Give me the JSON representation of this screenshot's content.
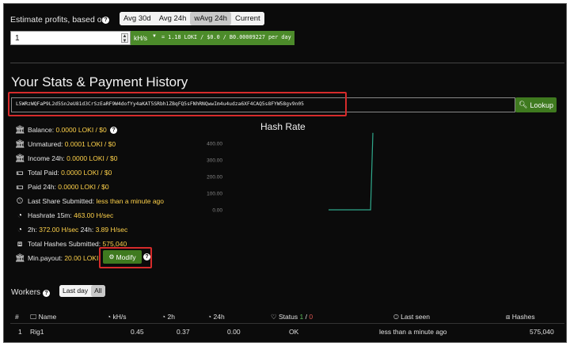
{
  "estimate": {
    "label": "Estimate profits, based on",
    "tabs": [
      "Avg 30d",
      "Avg 24h",
      "wAvg 24h",
      "Current"
    ],
    "active_tab": "wAvg 24h",
    "hashrate_value": "1",
    "unit": "kH/s",
    "result": "= 1.18 LOKI / $0.0 / B0.00009227 per day"
  },
  "stats": {
    "title": "Your Stats & Payment History",
    "address": "L5WRzWQFaP9L2d5Sn2eU81d3CrSzEaRF9W4dofYy4aKAT5SRbh1ZBqFQ5sFNhRNQwwIm4u4udza6XF4CAQ5s8FYW58gv9n05",
    "lookup_label": "Lookup"
  },
  "items": {
    "balance": {
      "label": "Balance:",
      "value": "0.0000 LOKI / $0"
    },
    "unmatured": {
      "label": "Unmatured:",
      "value": "0.0001 LOKI / $0"
    },
    "income24": {
      "label": "Income 24h:",
      "value": "0.0000 LOKI / $0"
    },
    "total_paid": {
      "label": "Total Paid:",
      "value": "0.0000 LOKI / $0"
    },
    "paid24": {
      "label": "Paid 24h:",
      "value": "0.0000 LOKI / $0"
    },
    "last_share": {
      "label": "Last Share Submitted:",
      "value": "less than a minute ago"
    },
    "hashrate15": {
      "label": "Hashrate 15m:",
      "value": "463.00 H/sec"
    },
    "hashrate2h": {
      "label2h": "2h:",
      "value2h": "372.00 H/sec",
      "label24": "24h:",
      "value24": "3.89 H/sec"
    },
    "total_hashes": {
      "label": "Total Hashes Submitted:",
      "value": "575,040"
    },
    "min_payout": {
      "label": "Min.payout:",
      "value": "20.00 LOKI",
      "modify_label": "Modify"
    }
  },
  "chart": {
    "title": "Hash Rate",
    "ticks": [
      "400.00",
      "300.00",
      "200.00",
      "100.00",
      "0.00"
    ]
  },
  "chart_data": {
    "type": "line",
    "title": "Hash Rate",
    "y_ticks": [
      400,
      300,
      200,
      100,
      0
    ],
    "ylim": [
      0,
      400
    ],
    "series": [
      {
        "values": [
          0,
          0,
          0,
          0,
          0,
          0,
          0,
          0,
          0,
          0,
          0,
          0,
          0,
          0,
          0,
          0,
          0,
          0,
          0,
          463
        ]
      }
    ]
  },
  "workers": {
    "title": "Workers",
    "toggle": [
      "Last day",
      "All"
    ],
    "headers": {
      "num": "#",
      "name": "Name",
      "khs": "kH/s",
      "h2": "2h",
      "h24": "24h",
      "status": "Status",
      "status_ok": "1",
      "status_sep": "/",
      "status_bad": "0",
      "last_seen": "Last seen",
      "hashes": "Hashes"
    },
    "rows": [
      {
        "num": "1",
        "name": "Rig1",
        "khs": "0.45",
        "h2": "0.37",
        "h24": "0.00",
        "status": "OK",
        "last_seen": "less than a minute ago",
        "hashes": "575,040"
      }
    ]
  }
}
